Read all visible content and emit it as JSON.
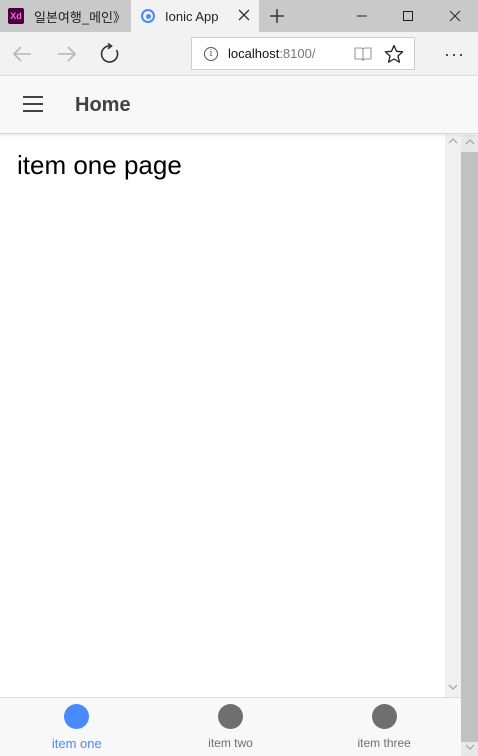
{
  "browser": {
    "tabs": [
      {
        "label": "일본여행_메인》"
      },
      {
        "label": "Ionic App"
      }
    ],
    "address": {
      "host": "localhost",
      "port": ":8100/"
    }
  },
  "app": {
    "header_title": "Home",
    "page_title": "item one page",
    "tabs": [
      {
        "label": "item one",
        "selected": true
      },
      {
        "label": "item two",
        "selected": false
      },
      {
        "label": "item three",
        "selected": false
      }
    ]
  },
  "colors": {
    "accent": "#488aff",
    "tab_inactive": "#6f6f6f",
    "header_bg": "#f8f8f8"
  },
  "icons": {
    "browser_tab_inactive": "adobe-xd-icon",
    "browser_tab_active": "ionic-favicon",
    "menu": "hamburger-icon",
    "tabs": [
      "tab-circle-icon",
      "tab-circle-icon",
      "tab-circle-icon"
    ]
  }
}
